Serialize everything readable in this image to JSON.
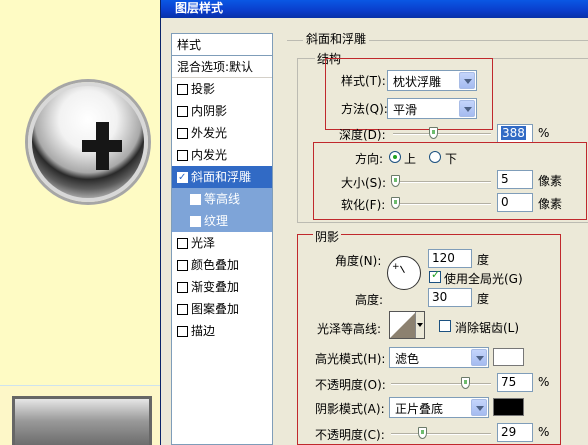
{
  "window": {
    "title": "图层样式"
  },
  "style_list": {
    "header": "样式",
    "blend_options": "混合选项:默认",
    "items": [
      {
        "label": "投影",
        "checked": false
      },
      {
        "label": "内阴影",
        "checked": false
      },
      {
        "label": "外发光",
        "checked": false
      },
      {
        "label": "内发光",
        "checked": false
      },
      {
        "label": "斜面和浮雕",
        "checked": true,
        "selected": true
      },
      {
        "label": "等高线",
        "checked": false,
        "sub": true
      },
      {
        "label": "纹理",
        "checked": false,
        "sub": true
      },
      {
        "label": "光泽",
        "checked": false
      },
      {
        "label": "颜色叠加",
        "checked": false
      },
      {
        "label": "渐变叠加",
        "checked": false
      },
      {
        "label": "图案叠加",
        "checked": false
      },
      {
        "label": "描边",
        "checked": false
      }
    ]
  },
  "bevel": {
    "section_title": "斜面和浮雕",
    "structure_title": "结构",
    "style_label": "样式(T):",
    "style_value": "枕状浮雕",
    "technique_label": "方法(Q):",
    "technique_value": "平滑",
    "depth_label": "深度(D):",
    "depth_value": "388",
    "depth_unit": "%",
    "direction_label": "方向:",
    "direction_up": "上",
    "direction_down": "下",
    "size_label": "大小(S):",
    "size_value": "5",
    "size_unit": "像素",
    "soften_label": "软化(F):",
    "soften_value": "0",
    "soften_unit": "像素"
  },
  "shading": {
    "title": "阴影",
    "angle_label": "角度(N):",
    "angle_value": "120",
    "angle_unit": "度",
    "global_light_label": "使用全局光(G)",
    "altitude_label": "高度:",
    "altitude_value": "30",
    "altitude_unit": "度",
    "gloss_contour_label": "光泽等高线:",
    "anti_aliased_label": "消除锯齿(L)",
    "highlight_mode_label": "高光模式(H):",
    "highlight_mode_value": "滤色",
    "highlight_color": "#ffffff",
    "highlight_opacity_label": "不透明度(O):",
    "highlight_opacity_value": "75",
    "highlight_opacity_unit": "%",
    "shadow_mode_label": "阴影模式(A):",
    "shadow_mode_value": "正片叠底",
    "shadow_color": "#000000",
    "shadow_opacity_label": "不透明度(C):",
    "shadow_opacity_value": "29",
    "shadow_opacity_unit": "%"
  }
}
